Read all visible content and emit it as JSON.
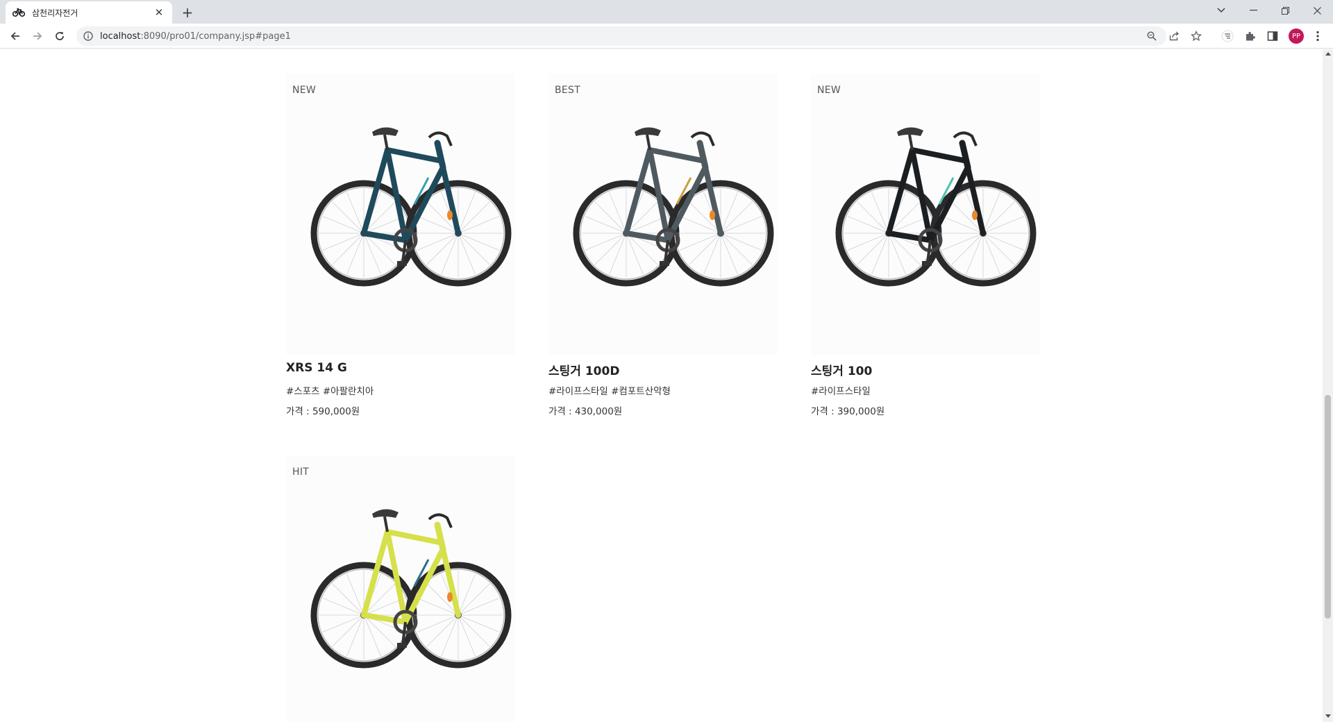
{
  "browser": {
    "tab_title": "삼천리자전거",
    "url_host": "localhost",
    "url_rest": ":8090/pro01/company.jsp#page1",
    "profile_initials": "PP"
  },
  "products": [
    {
      "badge": "NEW",
      "name": "XRS 14 G",
      "tags": "#스포츠 #아팔란치아",
      "price": "가격 : 590,000원",
      "color": "#1f4a5c",
      "accent": "#3aa0b0"
    },
    {
      "badge": "BEST",
      "name": "스팅거 100D",
      "tags": "#라이프스타일 #컴포트산악형",
      "price": "가격 : 430,000원",
      "color": "#4f5a60",
      "accent": "#c8a040"
    },
    {
      "badge": "NEW",
      "name": "스팅거 100",
      "tags": "#라이프스타일",
      "price": "가격 : 390,000원",
      "color": "#1c1f22",
      "accent": "#4fc2b0"
    },
    {
      "badge": "HIT",
      "name": "",
      "tags": "",
      "price": "",
      "color": "#d6e04a",
      "accent": "#2b6e8a"
    }
  ]
}
